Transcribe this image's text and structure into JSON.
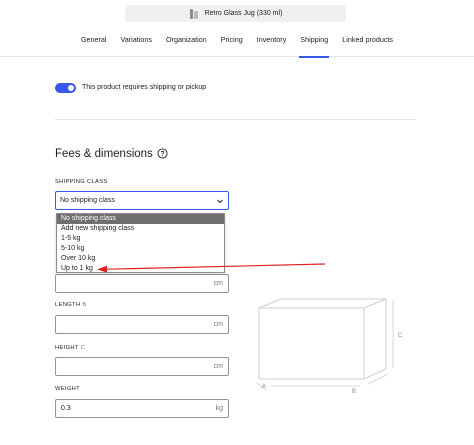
{
  "product": {
    "name": "Retro Glass Jug (330 ml)"
  },
  "tabs": [
    "General",
    "Variations",
    "Organization",
    "Pricing",
    "Inventory",
    "Shipping",
    "Linked products"
  ],
  "active_tab_index": 5,
  "shipping_toggle": {
    "label": "This product requires shipping or pickup",
    "checked": true
  },
  "fees": {
    "title": "Fees & dimensions",
    "shipping_class_label": "SHIPPING CLASS",
    "selected": "No shipping class",
    "options": [
      "No shipping class",
      "Add new shipping class",
      "1-5 kg",
      "5-10 kg",
      "Over 10 kg",
      "Up to 1 kg"
    ],
    "length_label": "LENGTH",
    "length_key": "B",
    "height_label": "HEIGHT",
    "height_key": "C",
    "weight_label": "WEIGHT",
    "width_unit": "cm",
    "length_unit": "cm",
    "height_unit": "cm",
    "weight_value": "0.3",
    "weight_unit": "kg"
  },
  "diagram": {
    "a": "A",
    "b": "B",
    "c": "C"
  },
  "colors": {
    "accent": "#3858e9",
    "annotation_arrow": "#e02020"
  }
}
